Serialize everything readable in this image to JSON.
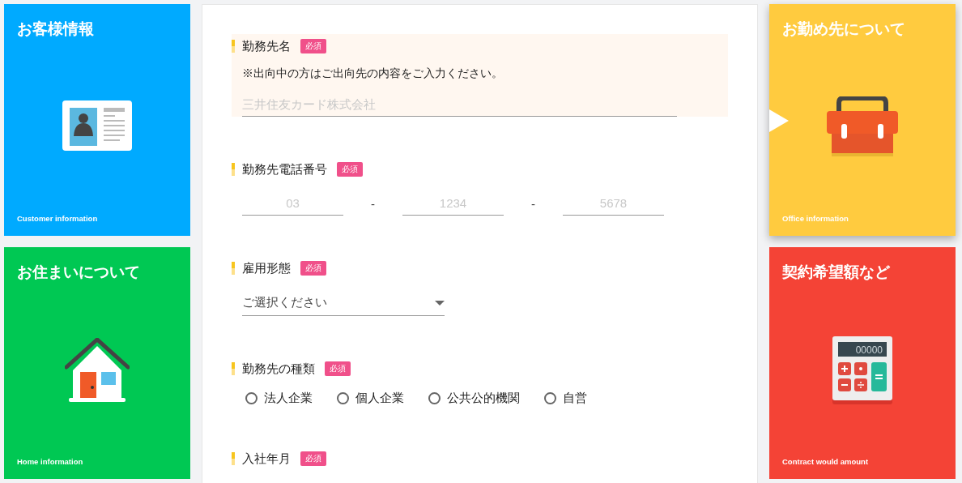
{
  "left_cards": [
    {
      "kind": "id-card",
      "title": "お客様情報",
      "subtitle": "Customer information",
      "color": "#00aaff",
      "selected": false
    },
    {
      "kind": "house",
      "title": "お住まいについて",
      "subtitle": "Home information",
      "color": "#00c853",
      "selected": false
    }
  ],
  "form": {
    "sections": [
      {
        "kind": "text",
        "label": "勤務先名",
        "badge": "必須",
        "highlighted": true,
        "note": "※出向中の方はご出向先の内容をご入力ください。",
        "placeholder": "三井住友カード株式会社"
      },
      {
        "kind": "phone",
        "label": "勤務先電話番号",
        "badge": "必須",
        "parts": [
          {
            "placeholder": "03"
          },
          {
            "placeholder": "1234"
          },
          {
            "placeholder": "5678"
          }
        ],
        "separators": [
          "-",
          "-"
        ]
      },
      {
        "kind": "select",
        "label": "雇用形態",
        "badge": "必須",
        "value": "ご選択ください"
      },
      {
        "kind": "radio",
        "label": "勤務先の種類",
        "badge": "必須",
        "options": [
          {
            "label": "法人企業",
            "selected": false
          },
          {
            "label": "個人企業",
            "selected": false
          },
          {
            "label": "公共公的機関",
            "selected": false
          },
          {
            "label": "自営",
            "selected": false
          }
        ]
      },
      {
        "kind": "heading",
        "label": "入社年月",
        "badge": "必須"
      }
    ]
  },
  "right_cards": [
    {
      "kind": "toolbox",
      "title": "お勤め先について",
      "subtitle": "Office information",
      "color": "#ffcb3f",
      "selected": true
    },
    {
      "kind": "calculator",
      "title": "契約希望額など",
      "subtitle": "Contract would amount",
      "color": "#f44336",
      "selected": false,
      "display": "00000"
    }
  ]
}
